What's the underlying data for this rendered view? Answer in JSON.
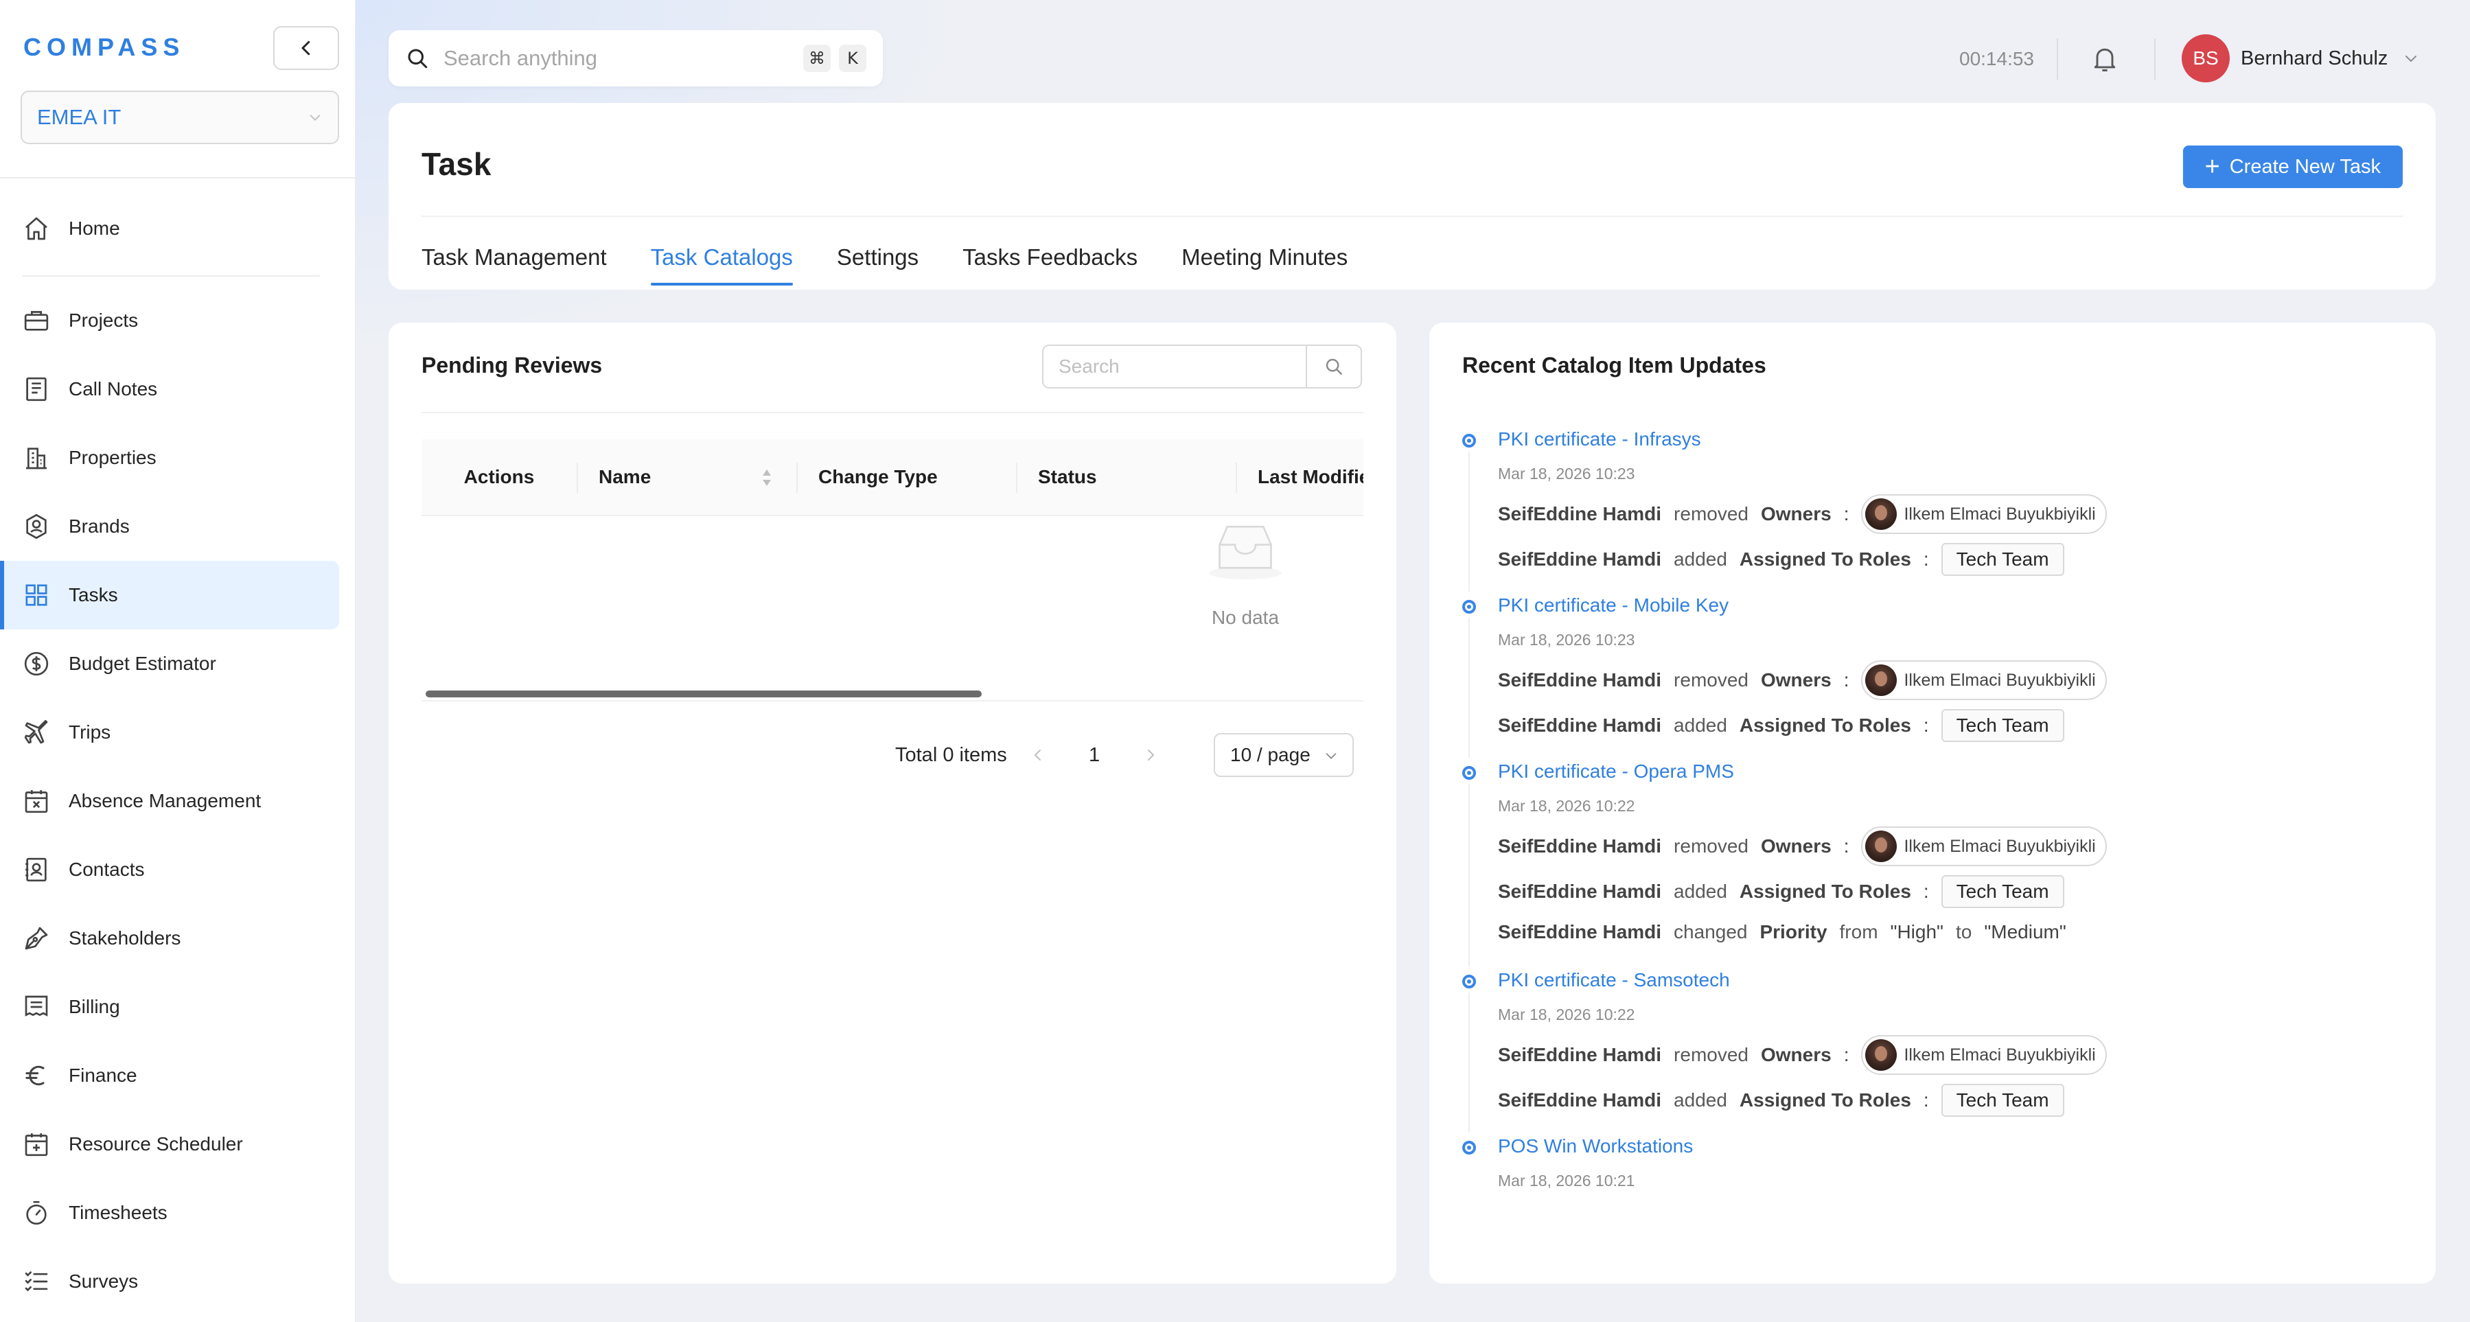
{
  "app": {
    "logo": "COMPASS",
    "org_selector": "EMEA IT"
  },
  "sidebar": {
    "items": [
      {
        "label": "Home",
        "icon": "home-icon"
      },
      {
        "label": "Projects",
        "icon": "briefcase-icon"
      },
      {
        "label": "Call Notes",
        "icon": "notes-icon"
      },
      {
        "label": "Properties",
        "icon": "building-icon"
      },
      {
        "label": "Brands",
        "icon": "brand-badge-icon"
      },
      {
        "label": "Tasks",
        "icon": "grid-icon",
        "active": true
      },
      {
        "label": "Budget Estimator",
        "icon": "dollar-icon"
      },
      {
        "label": "Trips",
        "icon": "plane-icon"
      },
      {
        "label": "Absence Management",
        "icon": "calendar-x-icon"
      },
      {
        "label": "Contacts",
        "icon": "contacts-icon"
      },
      {
        "label": "Stakeholders",
        "icon": "pen-icon"
      },
      {
        "label": "Billing",
        "icon": "billing-icon"
      },
      {
        "label": "Finance",
        "icon": "euro-icon"
      },
      {
        "label": "Resource Scheduler",
        "icon": "calendar-plus-icon"
      },
      {
        "label": "Timesheets",
        "icon": "stopwatch-icon"
      },
      {
        "label": "Surveys",
        "icon": "checklist-icon"
      }
    ]
  },
  "topbar": {
    "search_placeholder": "Search anything",
    "shortcut_key1": "⌘",
    "shortcut_key2": "K",
    "timer": "00:14:53",
    "user_initials": "BS",
    "user_name": "Bernhard Schulz",
    "accent_color": "#2f7fe0",
    "avatar_color": "#d7444c"
  },
  "header": {
    "title": "Task",
    "create_button": "Create New Task",
    "tabs": [
      {
        "label": "Task Management"
      },
      {
        "label": "Task Catalogs",
        "active": true
      },
      {
        "label": "Settings"
      },
      {
        "label": "Tasks Feedbacks"
      },
      {
        "label": "Meeting Minutes"
      }
    ]
  },
  "pending": {
    "title": "Pending Reviews",
    "search_placeholder": "Search",
    "columns": [
      "Actions",
      "Name",
      "Change Type",
      "Status",
      "Last Modifie"
    ],
    "empty_text": "No data",
    "total": "Total 0 items",
    "page": "1",
    "page_size": "10 / page"
  },
  "updates": {
    "title": "Recent Catalog Item Updates",
    "items": [
      {
        "title": "PKI certificate - Infrasys",
        "date": "Mar 18, 2026 10:23",
        "owner_change": {
          "actor": "SeifEddine Hamdi",
          "verb": "removed",
          "field": "Owners",
          "value": "Ilkem Elmaci Buyukbiyikli"
        },
        "role_change": {
          "actor": "SeifEddine Hamdi",
          "verb": "added",
          "field": "Assigned To Roles",
          "value": "Tech Team"
        }
      },
      {
        "title": "PKI certificate - Mobile Key",
        "date": "Mar 18, 2026 10:23",
        "owner_change": {
          "actor": "SeifEddine Hamdi",
          "verb": "removed",
          "field": "Owners",
          "value": "Ilkem Elmaci Buyukbiyikli"
        },
        "role_change": {
          "actor": "SeifEddine Hamdi",
          "verb": "added",
          "field": "Assigned To Roles",
          "value": "Tech Team"
        }
      },
      {
        "title": "PKI certificate - Opera PMS",
        "date": "Mar 18, 2026 10:22",
        "owner_change": {
          "actor": "SeifEddine Hamdi",
          "verb": "removed",
          "field": "Owners",
          "value": "Ilkem Elmaci Buyukbiyikli"
        },
        "role_change": {
          "actor": "SeifEddine Hamdi",
          "verb": "added",
          "field": "Assigned To Roles",
          "value": "Tech Team"
        },
        "priority_change": {
          "actor": "SeifEddine Hamdi",
          "verb": "changed",
          "field": "Priority",
          "from_word": "from",
          "from": "\"High\"",
          "to_word": "to",
          "to": "\"Medium\""
        }
      },
      {
        "title": "PKI certificate - Samsotech",
        "date": "Mar 18, 2026 10:22",
        "owner_change": {
          "actor": "SeifEddine Hamdi",
          "verb": "removed",
          "field": "Owners",
          "value": "Ilkem Elmaci Buyukbiyikli"
        },
        "role_change": {
          "actor": "SeifEddine Hamdi",
          "verb": "added",
          "field": "Assigned To Roles",
          "value": "Tech Team"
        }
      },
      {
        "title": "POS Win Workstations",
        "date": "Mar 18, 2026 10:21"
      }
    ]
  }
}
